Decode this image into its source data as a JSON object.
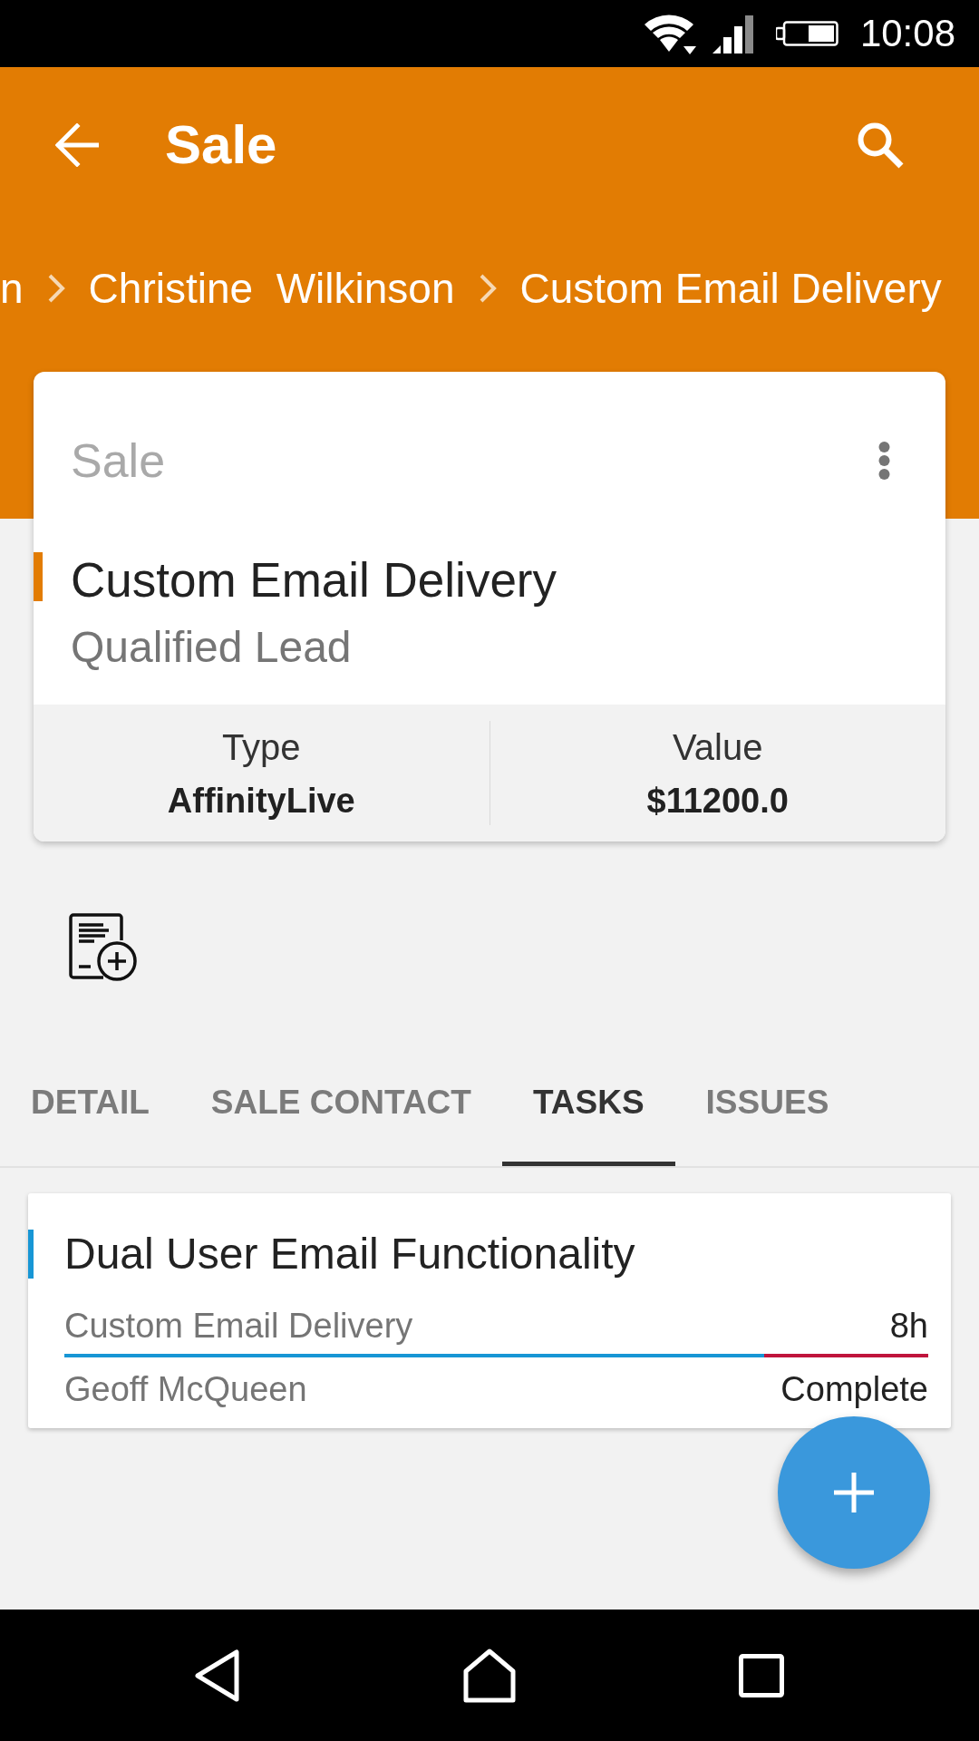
{
  "status_bar": {
    "time": "10:08"
  },
  "app_bar": {
    "title": "Sale"
  },
  "breadcrumb": [
    {
      "label": "n"
    },
    {
      "label": "Christine  Wilkinson"
    },
    {
      "label": "Custom Email Delivery"
    }
  ],
  "sale_card": {
    "heading": "Sale",
    "title": "Custom Email Delivery",
    "stage": "Qualified Lead",
    "fields": [
      {
        "label": "Type",
        "value": "AffinityLive"
      },
      {
        "label": "Value",
        "value": "$11200.0"
      }
    ]
  },
  "tabs": [
    {
      "label": "DETAIL",
      "selected": false
    },
    {
      "label": "SALE CONTACT",
      "selected": false
    },
    {
      "label": "TASKS",
      "selected": true
    },
    {
      "label": "ISSUES",
      "selected": false
    }
  ],
  "tasks": [
    {
      "title": "Dual User Email Functionality",
      "sale": "Custom Email Delivery",
      "hours": "8h",
      "level": 0.81,
      "assignee": "Geoff McQueen",
      "status": "Complete"
    }
  ]
}
